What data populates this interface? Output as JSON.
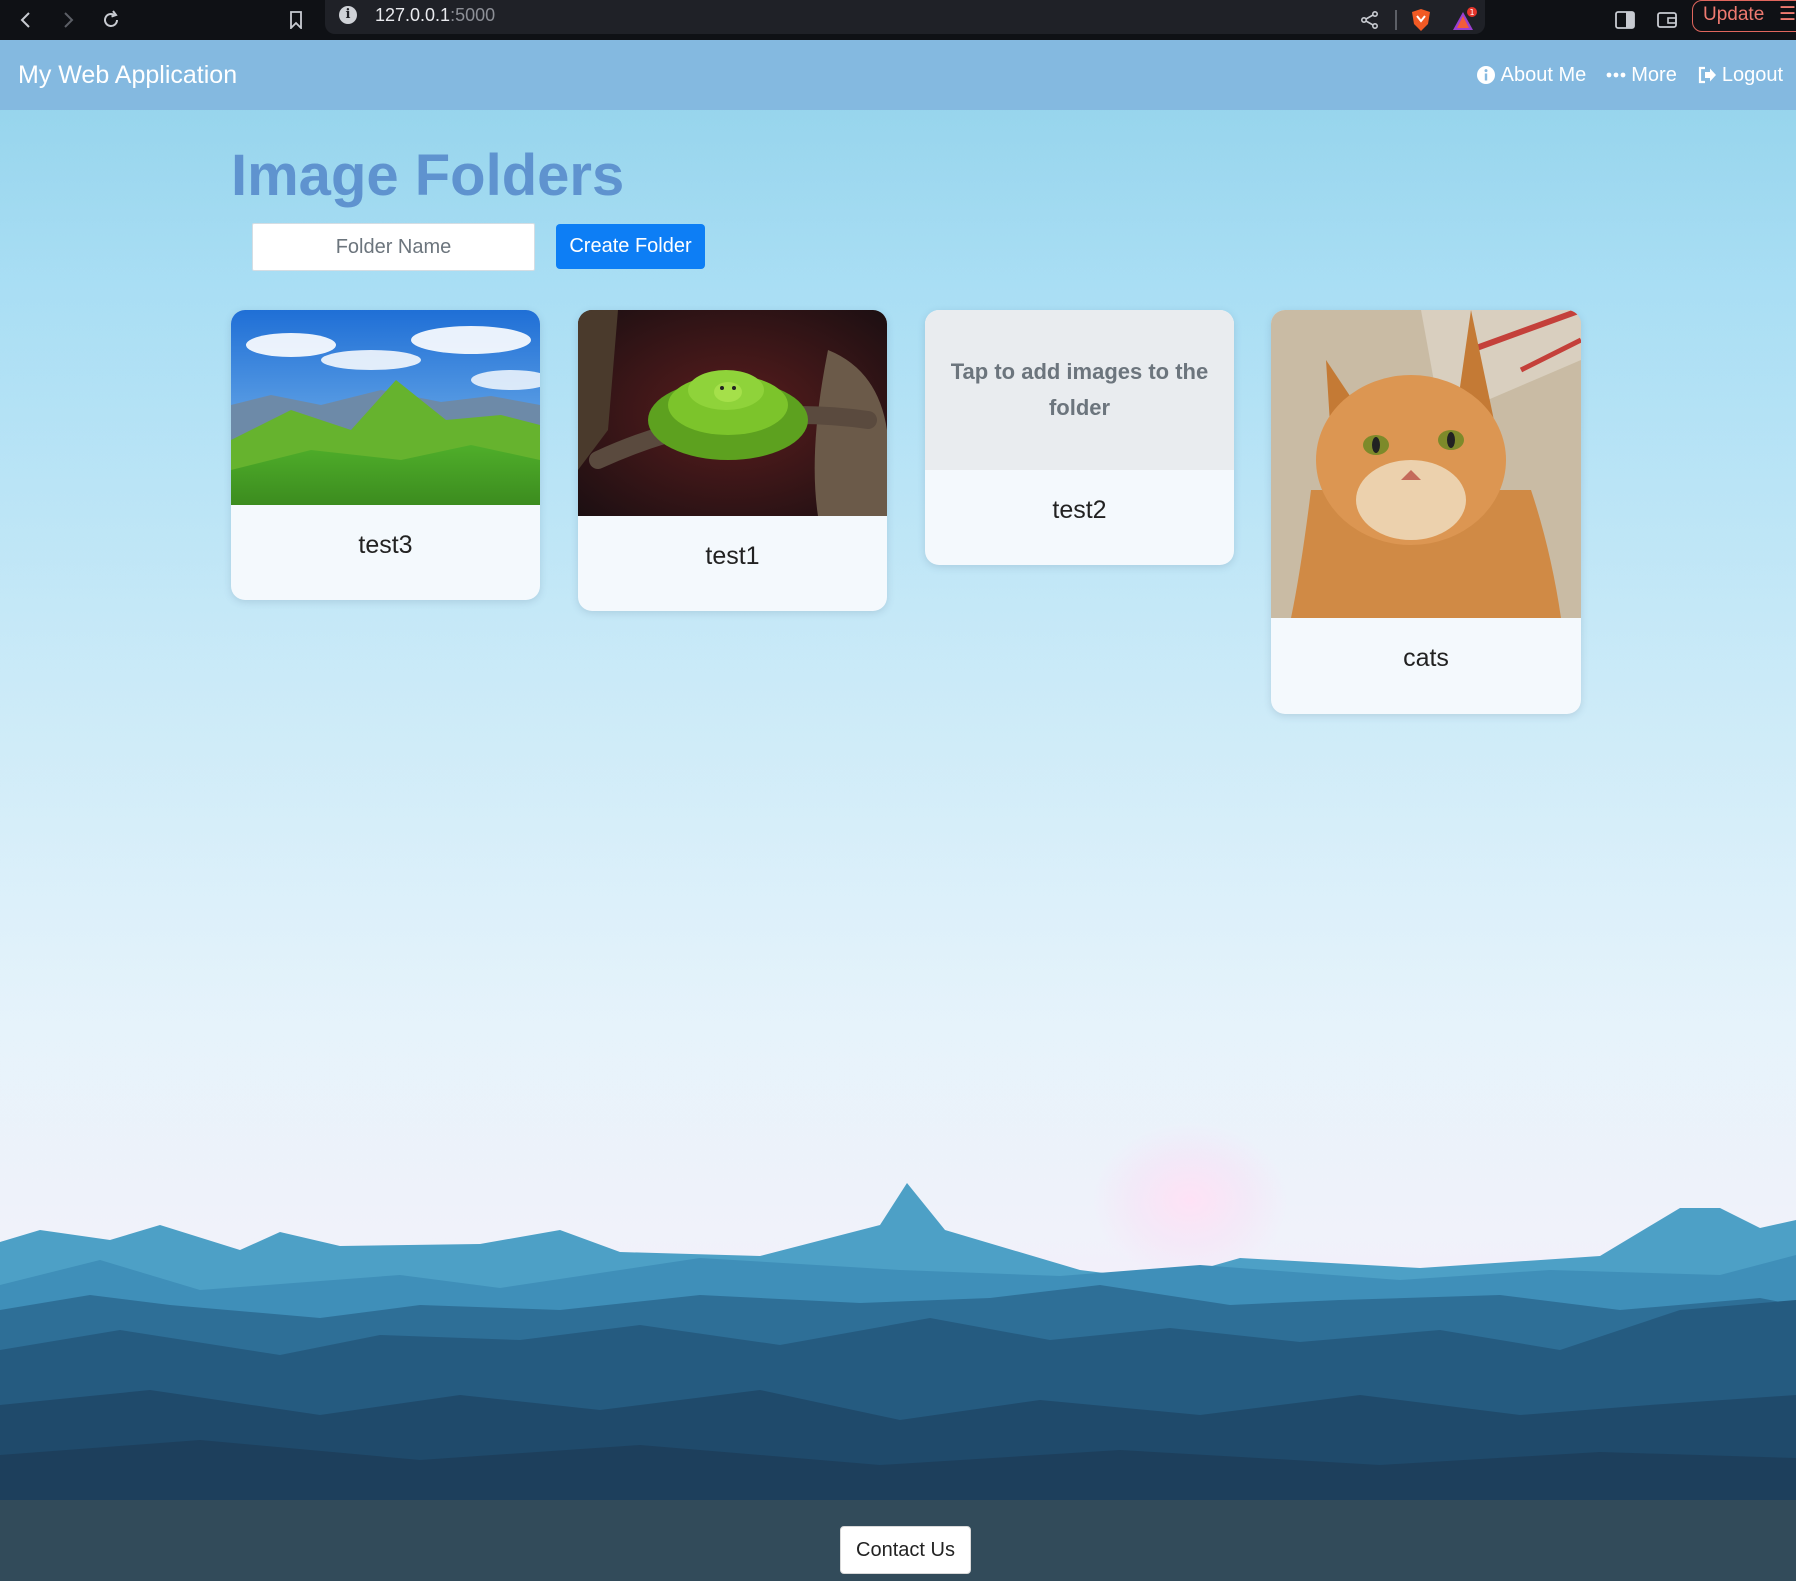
{
  "browser": {
    "url_host": "127.0.0.1",
    "url_port": ":5000",
    "update_label": "Update"
  },
  "navbar": {
    "brand": "My Web Application",
    "links": [
      {
        "label": "About Me",
        "icon": "info-circle-icon"
      },
      {
        "label": "More",
        "icon": "ellipsis-icon"
      },
      {
        "label": "Logout",
        "icon": "sign-out-icon"
      }
    ]
  },
  "main": {
    "title": "Image Folders",
    "folder_input_placeholder": "Folder Name",
    "create_button": "Create Folder"
  },
  "folders": [
    {
      "name": "test3",
      "image": "green hills landscape"
    },
    {
      "name": "test1",
      "image": "green snake on branch"
    },
    {
      "name": "test2",
      "empty_text": "Tap to add images to the folder"
    },
    {
      "name": "cats",
      "image": "orange cat"
    }
  ],
  "footer": {
    "contact_button": "Contact Us"
  },
  "colors": {
    "navbar": "#84b9e0",
    "title": "#5f93cf",
    "primary_button": "#0d7ef5",
    "footer": "#324b5a"
  }
}
